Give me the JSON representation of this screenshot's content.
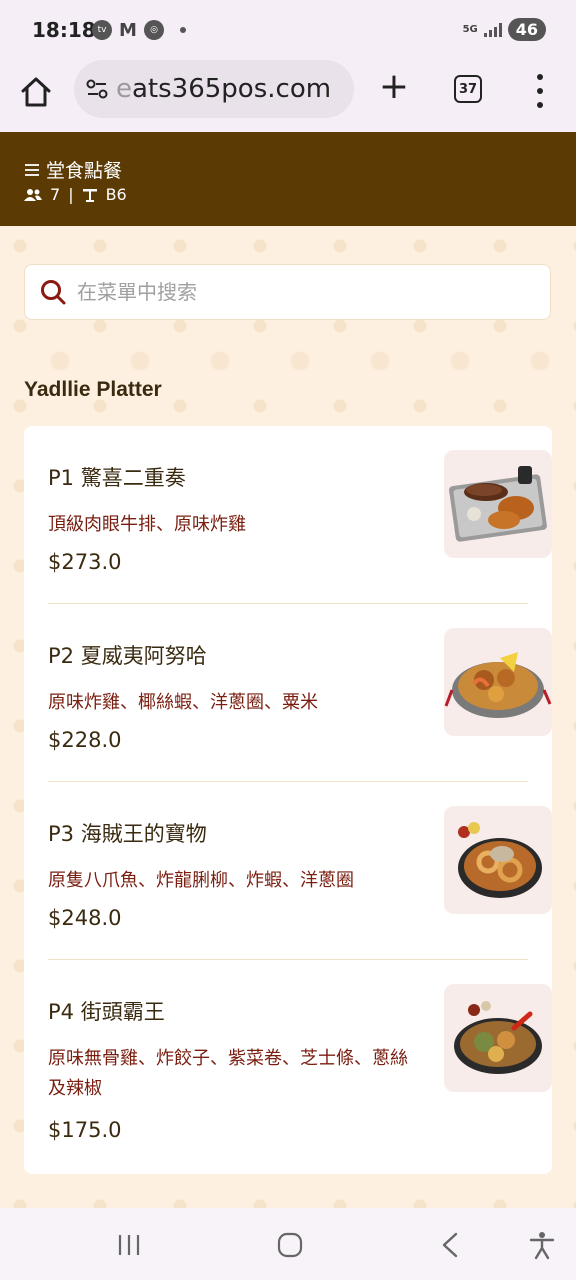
{
  "status_bar": {
    "time": "18:18",
    "left_icons": [
      "hktv-icon",
      "gmail-icon",
      "browser-icon"
    ],
    "network": "5G",
    "battery": "46"
  },
  "browser": {
    "url_prefix": "e",
    "url_main": "ats365pos.com",
    "tab_count": "37"
  },
  "header": {
    "title": "堂食點餐",
    "guests": "7",
    "separator": "|",
    "table": "B6"
  },
  "search": {
    "placeholder": "在菜單中搜索"
  },
  "section": {
    "title": "Yadllie Platter"
  },
  "items": [
    {
      "name": "P1 驚喜二重奏",
      "desc": "頂級肉眼牛排、原味炸雞",
      "price": "$273.0"
    },
    {
      "name": "P2 夏威夷阿努哈",
      "desc": "原味炸雞、椰絲蝦、洋蔥圈、粟米",
      "price": "$228.0"
    },
    {
      "name": "P3 海賊王的寶物",
      "desc": "原隻八爪魚、炸龍脷柳、炸蝦、洋蔥圈",
      "price": "$248.0"
    },
    {
      "name": "P4 街頭霸王",
      "desc": "原味無骨雞、炸餃子、紫菜卷、芝士條、蔥絲及辣椒",
      "price": "$175.0"
    }
  ],
  "colors": {
    "header_bg": "#5b3a04",
    "page_bg": "#fdf0e0",
    "desc_text": "#7a1e10",
    "search_icon": "#8a1a10"
  }
}
